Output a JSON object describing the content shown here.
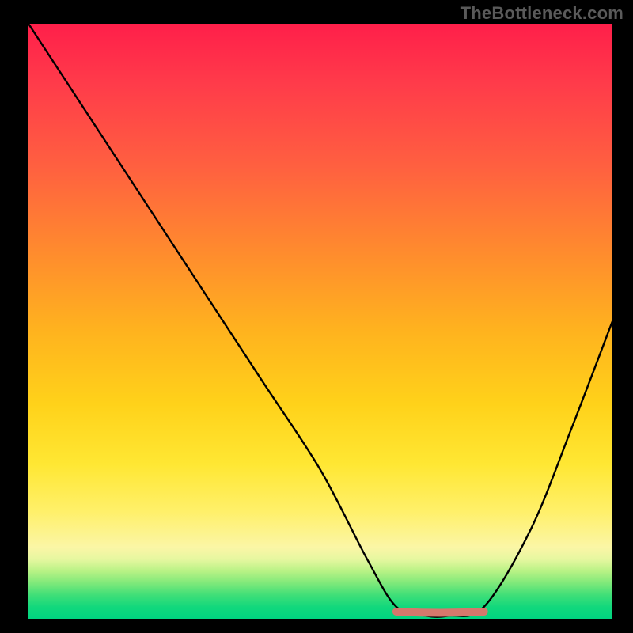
{
  "watermark": "TheBottleneck.com",
  "chart_data": {
    "type": "line",
    "title": "",
    "xlabel": "",
    "ylabel": "",
    "xlim": [
      0,
      100
    ],
    "ylim": [
      0,
      100
    ],
    "series": [
      {
        "name": "bottleneck-curve",
        "x": [
          0,
          10,
          20,
          30,
          40,
          50,
          58,
          63,
          68,
          72,
          78,
          86,
          93,
          100
        ],
        "values": [
          100,
          85,
          70,
          55,
          40,
          25,
          10,
          2,
          0.5,
          0.5,
          2,
          15,
          32,
          50
        ]
      }
    ],
    "highlight": {
      "name": "optimal-range",
      "x_start": 63,
      "x_end": 78,
      "y": 1.2,
      "color": "#d5786c"
    },
    "gradient_stops": [
      {
        "pos": 0,
        "color": "#ff1f4a"
      },
      {
        "pos": 50,
        "color": "#ffd21a"
      },
      {
        "pos": 90,
        "color": "#e6f7a0"
      },
      {
        "pos": 100,
        "color": "#00d480"
      }
    ]
  }
}
